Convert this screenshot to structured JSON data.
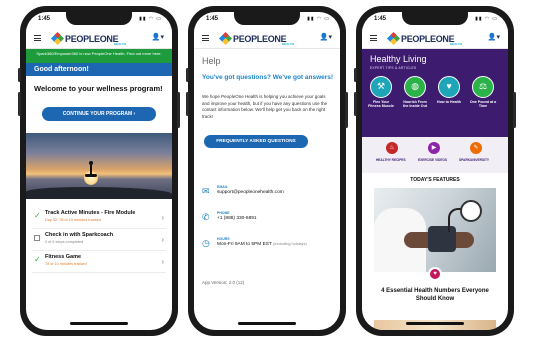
{
  "status": {
    "time": "1:45"
  },
  "brand": {
    "word": "PEOPLEONE",
    "sub": "HEALTH"
  },
  "icons": {
    "menu": "hamburger-icon",
    "user": "user-icon"
  },
  "colors": {
    "navy": "#1d2d5b",
    "blue": "#1d66b2",
    "green": "#1e9b3d",
    "purple": "#3d1c70",
    "orange": "#e07a2a"
  },
  "phone1": {
    "banner": "Spark360/Empower360 is now PeopleOne Health. Find out more here.",
    "greeting": "Good afternoon!",
    "welcome": "Welcome to your wellness program!",
    "cta": "CONTINUE YOUR PROGRAM",
    "tasks": [
      {
        "title": "Track Active Minutes - Fire Module",
        "sub": "Day 32: 78 of 10 minutes tracked",
        "done": true
      },
      {
        "title": "Check in with Sparkcoach",
        "sub": "0 of 6 steps completed",
        "done": false
      },
      {
        "title": "Fitness Game",
        "sub": "78 of 10 minutes tracked",
        "done": true
      }
    ]
  },
  "phone2": {
    "title": "Help",
    "question": "You've got questions? We've got answers!",
    "body": "We hope PeopleOne Health is helping you achieve your goals and improve your health, but if you have any questions use the contact information below. We'll help get you back on the right track!",
    "faq": "FREQUENTLY ASKED QUESTIONS",
    "email": {
      "label": "EMAIL",
      "value": "support@peopleonehealth.com"
    },
    "phone": {
      "label": "PHONE",
      "value": "+1 (888) 330-6891"
    },
    "hours": {
      "label": "HOURS",
      "value": "Mon-Fri 9AM to 5PM EST",
      "note": "(excluding holidays)"
    },
    "version": "App Version: 2.0 (12)"
  },
  "phone3": {
    "title": "Healthy Living",
    "subtitle": "EXPERT TIPS & ARTICLES",
    "circles": [
      {
        "label": "Flex Your Fitness Muscle",
        "icon": "dumbbell-icon"
      },
      {
        "label": "Nourish From the Inside Out",
        "icon": "apple-icon"
      },
      {
        "label": "How to Health",
        "icon": "heart-icon"
      },
      {
        "label": "One Pound at a Time",
        "icon": "scale-icon"
      }
    ],
    "categories": [
      {
        "label": "HEALTHY RECIPES",
        "color": "#c62828"
      },
      {
        "label": "EXERCISE VIDEOS",
        "color": "#8e24aa"
      },
      {
        "label": "SPARKUNIVERSITY",
        "color": "#ef6c00"
      }
    ],
    "features_heading": "TODAY'S FEATURES",
    "feature_title": "4 Essential Health Numbers Everyone Should Know"
  }
}
